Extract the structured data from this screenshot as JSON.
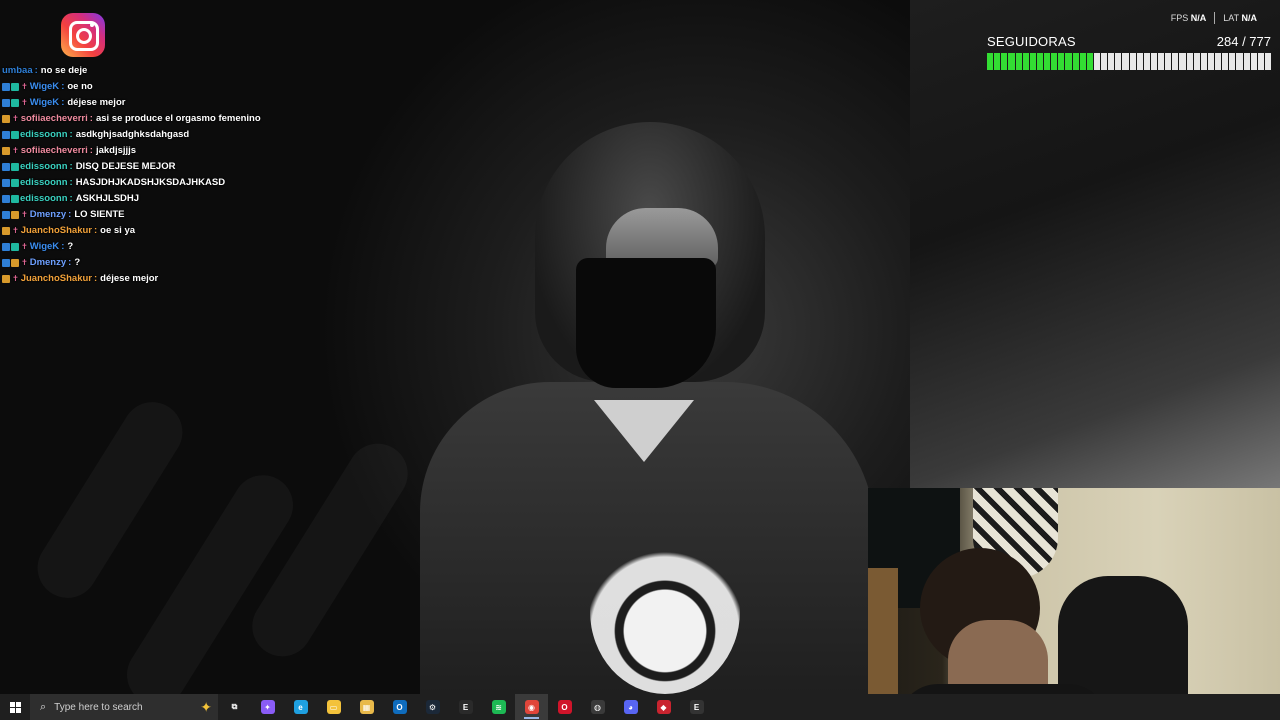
{
  "hud": {
    "fps_label": "FPS",
    "fps_value": "N/A",
    "lat_label": "LAT",
    "lat_value": "N/A"
  },
  "follower_goal": {
    "title": "SEGUIDORAS",
    "count_text": "284 / 777",
    "current": 284,
    "target": 777,
    "fill_color": "#33dd33",
    "empty_color": "#e8e8e8"
  },
  "chat": {
    "messages": [
      {
        "user": "umbaa",
        "text": "no se deje",
        "color": "#2f7fd6",
        "badges": []
      },
      {
        "user": "WigeK",
        "text": "oe no",
        "color": "#3b8ef0",
        "badges": [
          "mod",
          "sub",
          "star"
        ]
      },
      {
        "user": "WigeK",
        "text": "déjese mejor",
        "color": "#3b8ef0",
        "badges": [
          "mod",
          "sub",
          "star"
        ]
      },
      {
        "user": "sofiiaecheverri",
        "text": "asi se produce el orgasmo femenino",
        "color": "#f08ca0",
        "badges": [
          "gold",
          "star"
        ]
      },
      {
        "user": "edissoonn",
        "text": "asdkghjsadghksdahgasd",
        "color": "#3ad1c0",
        "badges": [
          "mod",
          "sub"
        ]
      },
      {
        "user": "sofiiaecheverri",
        "text": "jakdjsjjjs",
        "color": "#f08ca0",
        "badges": [
          "gold",
          "star"
        ]
      },
      {
        "user": "edissoonn",
        "text": "DISQ DEJESE MEJOR",
        "color": "#3ad1c0",
        "badges": [
          "mod",
          "sub"
        ]
      },
      {
        "user": "edissoonn",
        "text": "HASJDHJKADSHJKSDAJHKASD",
        "color": "#3ad1c0",
        "badges": [
          "mod",
          "sub"
        ]
      },
      {
        "user": "edissoonn",
        "text": "ASKHJLSDHJ",
        "color": "#3ad1c0",
        "badges": [
          "mod",
          "sub"
        ]
      },
      {
        "user": "Dmenzy",
        "text": "LO SIENTE",
        "color": "#6ea0ff",
        "badges": [
          "mod",
          "gold",
          "star"
        ]
      },
      {
        "user": "JuanchoShakur",
        "text": "oe si ya",
        "color": "#f2a23a",
        "badges": [
          "gold",
          "star"
        ]
      },
      {
        "user": "WigeK",
        "text": "?",
        "color": "#3b8ef0",
        "badges": [
          "mod",
          "sub",
          "star"
        ]
      },
      {
        "user": "Dmenzy",
        "text": "?",
        "color": "#6ea0ff",
        "badges": [
          "mod",
          "gold",
          "star"
        ]
      },
      {
        "user": "JuanchoShakur",
        "text": "déjese mejor",
        "color": "#f2a23a",
        "badges": [
          "gold",
          "star"
        ]
      }
    ]
  },
  "taskbar": {
    "search_placeholder": "Type here to search",
    "icons": [
      {
        "name": "task-view-icon",
        "glyph": "⧉",
        "bg": "transparent"
      },
      {
        "name": "copilot-icon",
        "glyph": "✦",
        "bg": "#8a5cf6"
      },
      {
        "name": "edge-icon",
        "glyph": "e",
        "bg": "#1fa0e0"
      },
      {
        "name": "file-explorer-icon",
        "glyph": "▭",
        "bg": "#f3c23b"
      },
      {
        "name": "microsoft-store-icon",
        "glyph": "▦",
        "bg": "#e8b94a"
      },
      {
        "name": "outlook-icon",
        "glyph": "O",
        "bg": "#0f6cbd"
      },
      {
        "name": "steam-icon",
        "glyph": "⚙",
        "bg": "#1b2838"
      },
      {
        "name": "epic-games-icon",
        "glyph": "E",
        "bg": "#2a2a2a"
      },
      {
        "name": "spotify-icon",
        "glyph": "≋",
        "bg": "#1db954"
      },
      {
        "name": "chrome-icon",
        "glyph": "◉",
        "bg": "#e0453a"
      },
      {
        "name": "opera-icon",
        "glyph": "O",
        "bg": "#d0142a"
      },
      {
        "name": "obs-icon",
        "glyph": "◍",
        "bg": "#3a3a3a"
      },
      {
        "name": "discord-icon",
        "glyph": "◕",
        "bg": "#5865f2"
      },
      {
        "name": "red-app-icon",
        "glyph": "◆",
        "bg": "#c9242f"
      },
      {
        "name": "epic-launcher-icon",
        "glyph": "E",
        "bg": "#333333"
      }
    ],
    "active_index": 9
  }
}
